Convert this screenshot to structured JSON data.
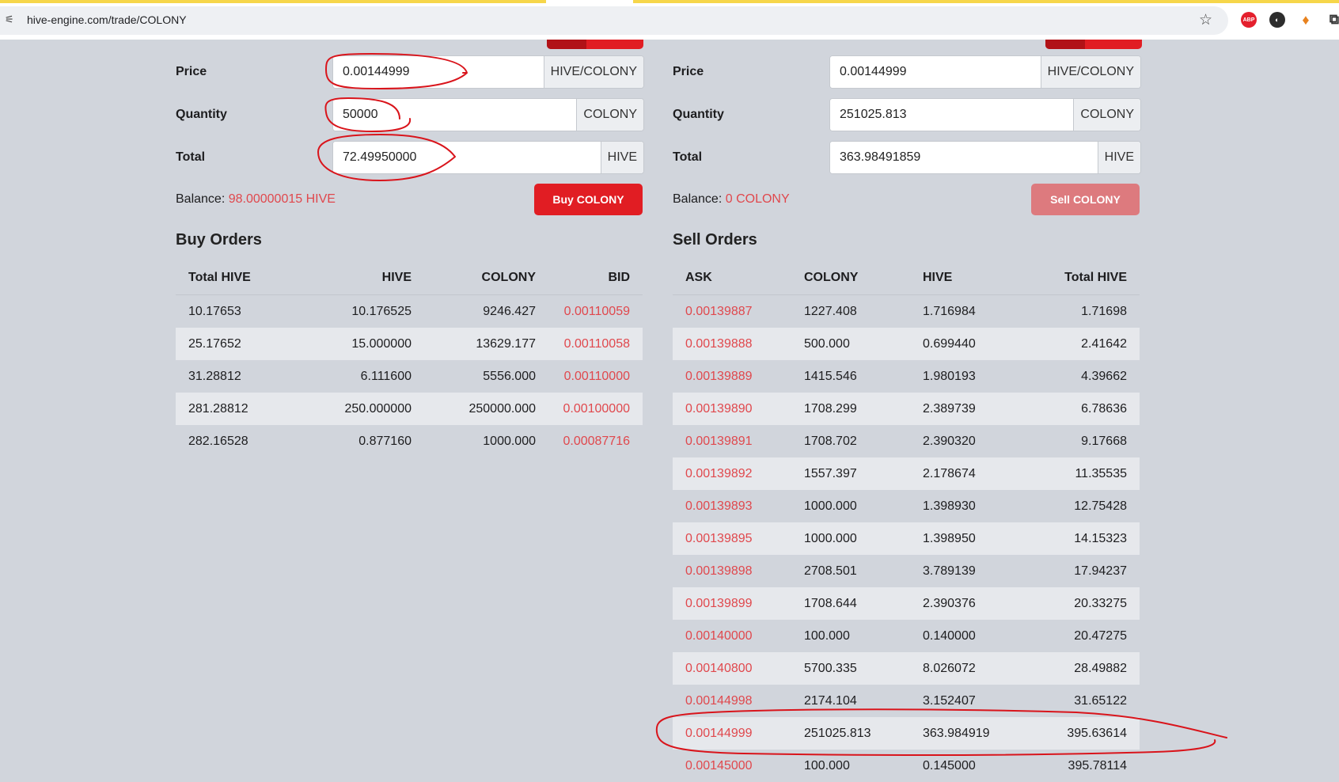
{
  "browser": {
    "url": "hive-engine.com/trade/COLONY",
    "extensions": [
      "abp-icon",
      "extension-icon",
      "metamask-fox-icon",
      "puzzle-extensions-icon"
    ]
  },
  "buy_form": {
    "price_label": "Price",
    "price_value": "0.00144999",
    "price_unit": "HIVE/COLONY",
    "quantity_label": "Quantity",
    "quantity_value": "50000",
    "quantity_unit": "COLONY",
    "total_label": "Total",
    "total_value": "72.49950000",
    "total_unit": "HIVE",
    "balance_label": "Balance:",
    "balance_value": "98.00000015 HIVE",
    "button_label": "Buy COLONY"
  },
  "sell_form": {
    "price_label": "Price",
    "price_value": "0.00144999",
    "price_unit": "HIVE/COLONY",
    "quantity_label": "Quantity",
    "quantity_value": "251025.813",
    "quantity_unit": "COLONY",
    "total_label": "Total",
    "total_value": "363.98491859",
    "total_unit": "HIVE",
    "balance_label": "Balance:",
    "balance_value": "0 COLONY",
    "button_label": "Sell COLONY"
  },
  "buy_orders": {
    "title": "Buy Orders",
    "columns": [
      "Total HIVE",
      "HIVE",
      "COLONY",
      "BID"
    ],
    "rows": [
      [
        "10.17653",
        "10.176525",
        "9246.427",
        "0.00110059"
      ],
      [
        "25.17652",
        "15.000000",
        "13629.177",
        "0.00110058"
      ],
      [
        "31.28812",
        "6.111600",
        "5556.000",
        "0.00110000"
      ],
      [
        "281.28812",
        "250.000000",
        "250000.000",
        "0.00100000"
      ],
      [
        "282.16528",
        "0.877160",
        "1000.000",
        "0.00087716"
      ]
    ]
  },
  "sell_orders": {
    "title": "Sell Orders",
    "columns": [
      "ASK",
      "COLONY",
      "HIVE",
      "Total HIVE"
    ],
    "rows": [
      [
        "0.00139887",
        "1227.408",
        "1.716984",
        "1.71698"
      ],
      [
        "0.00139888",
        "500.000",
        "0.699440",
        "2.41642"
      ],
      [
        "0.00139889",
        "1415.546",
        "1.980193",
        "4.39662"
      ],
      [
        "0.00139890",
        "1708.299",
        "2.389739",
        "6.78636"
      ],
      [
        "0.00139891",
        "1708.702",
        "2.390320",
        "9.17668"
      ],
      [
        "0.00139892",
        "1557.397",
        "2.178674",
        "11.35535"
      ],
      [
        "0.00139893",
        "1000.000",
        "1.398930",
        "12.75428"
      ],
      [
        "0.00139895",
        "1000.000",
        "1.398950",
        "14.15323"
      ],
      [
        "0.00139898",
        "2708.501",
        "3.789139",
        "17.94237"
      ],
      [
        "0.00139899",
        "1708.644",
        "2.390376",
        "20.33275"
      ],
      [
        "0.00140000",
        "100.000",
        "0.140000",
        "20.47275"
      ],
      [
        "0.00140800",
        "5700.335",
        "8.026072",
        "28.49882"
      ],
      [
        "0.00144998",
        "2174.104",
        "3.152407",
        "31.65122"
      ],
      [
        "0.00144999",
        "251025.813",
        "363.984919",
        "395.63614"
      ],
      [
        "0.00145000",
        "100.000",
        "0.145000",
        "395.78114"
      ]
    ]
  },
  "colors": {
    "accent_red": "#e11d23",
    "price_red": "#e0484d",
    "annotation_red": "#d9141b"
  }
}
